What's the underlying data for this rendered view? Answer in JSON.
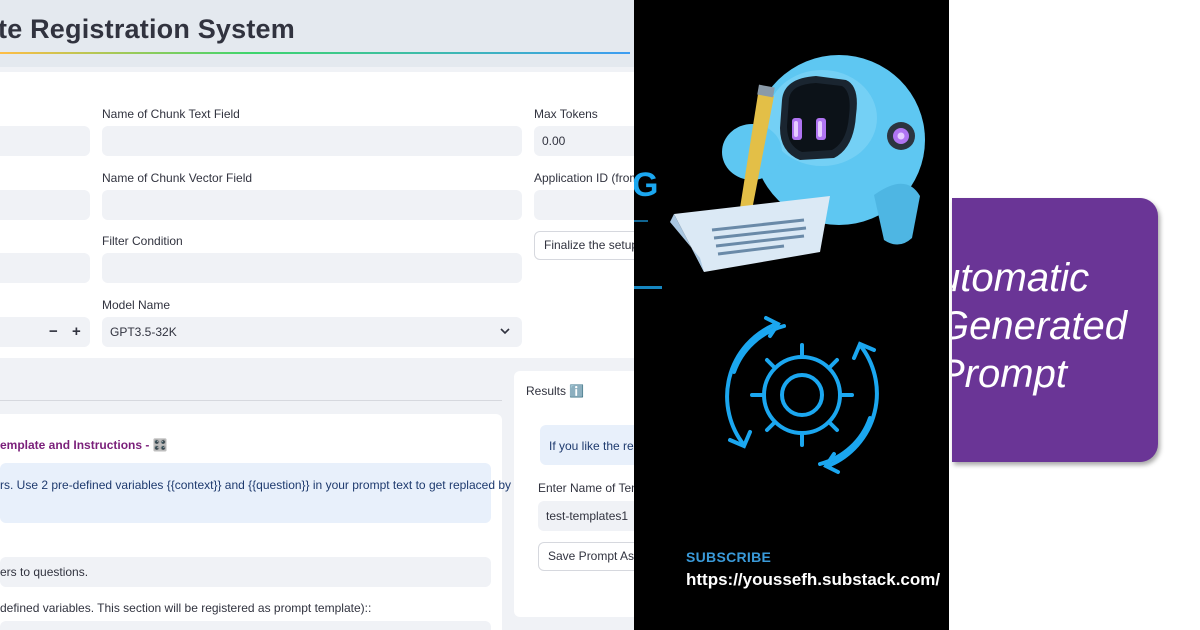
{
  "app": {
    "title": "te Registration System",
    "fields": {
      "chunk_text_label": "Name of Chunk Text Field",
      "chunk_vector_label": "Name of Chunk Vector Field",
      "filter_label": "Filter Condition",
      "model_label": "Model Name",
      "model_value": "GPT3.5-32K",
      "max_tokens_label": "Max Tokens",
      "max_tokens_value": "0.00",
      "app_id_label": "Application ID (from",
      "stepper_minus": "−",
      "stepper_plus": "+"
    },
    "finalize_button": "Finalize the setup",
    "section_heading": "emplate and Instructions - 🎛️",
    "info_text": "rs. Use 2 pre-defined variables {{context}} and {{question}} in your prompt text to get replaced by",
    "system_text": "ers to questions.",
    "template_text": "defined variables. This section will be registered as prompt template)::",
    "results": {
      "label": "Results ℹ️",
      "info_text": "If you like the res",
      "name_label": "Enter Name of Tem",
      "name_value": "test-templates1",
      "save_button": "Save Prompt As T"
    }
  },
  "promo": {
    "subscribe": "SUBSCRIBE",
    "url": "https://youssefh.substack.com/",
    "edge_glyph": "G"
  },
  "purple": {
    "line1": "utomatic",
    "line2": "Generated",
    "line3": "Prompt"
  },
  "colors": {
    "accent_purple": "#6a3596",
    "heading_purple": "#7a1f7a",
    "link_blue": "#3a9ad9",
    "neon_blue": "#1ba7f0",
    "app_bg": "#f0f2f6"
  },
  "icons": [
    "robot-illustration",
    "pencil-icon",
    "paper-icon",
    "gear-cycle-icon",
    "chevron-down-icon"
  ]
}
